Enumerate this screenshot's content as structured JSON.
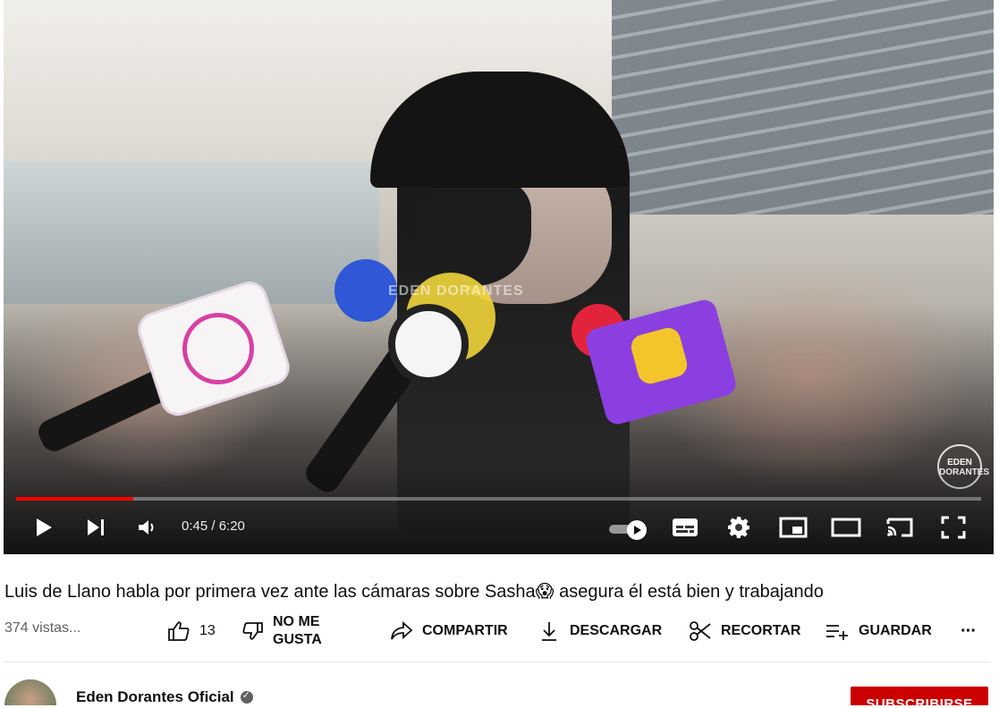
{
  "player": {
    "watermark_center": "EDEN DORANTES",
    "watermark_corner": "EDEN DORANTES",
    "progress": 0.1216,
    "progress_color": "#ff0000",
    "time_current": "0:45",
    "time_total": "6:20",
    "time_display": "0:45 / 6:20",
    "icons": [
      "play-icon",
      "next-icon",
      "volume-icon",
      "autoplay-toggle",
      "subtitles-icon",
      "settings-icon",
      "miniplayer-icon",
      "theater-icon",
      "cast-icon",
      "fullscreen-icon"
    ]
  },
  "video": {
    "title": "Luis de Llano habla por primera vez ante las cámaras sobre Sasha😱  asegura él está bien y trabajando",
    "views": "374 vistas..."
  },
  "actions": {
    "like_count": "13",
    "dislike_label_line1": "NO ME",
    "dislike_label_line2": "GUSTA",
    "share_label": "COMPARTIR",
    "download_label": "DESCARGAR",
    "clip_label": "RECORTAR",
    "save_label": "GUARDAR",
    "more_label": "···"
  },
  "channel": {
    "name": "Eden Dorantes Oficial",
    "verified": true,
    "subscribe_label": "SUBSCRIBIRSE",
    "subscribe_color": "#cc0000"
  }
}
